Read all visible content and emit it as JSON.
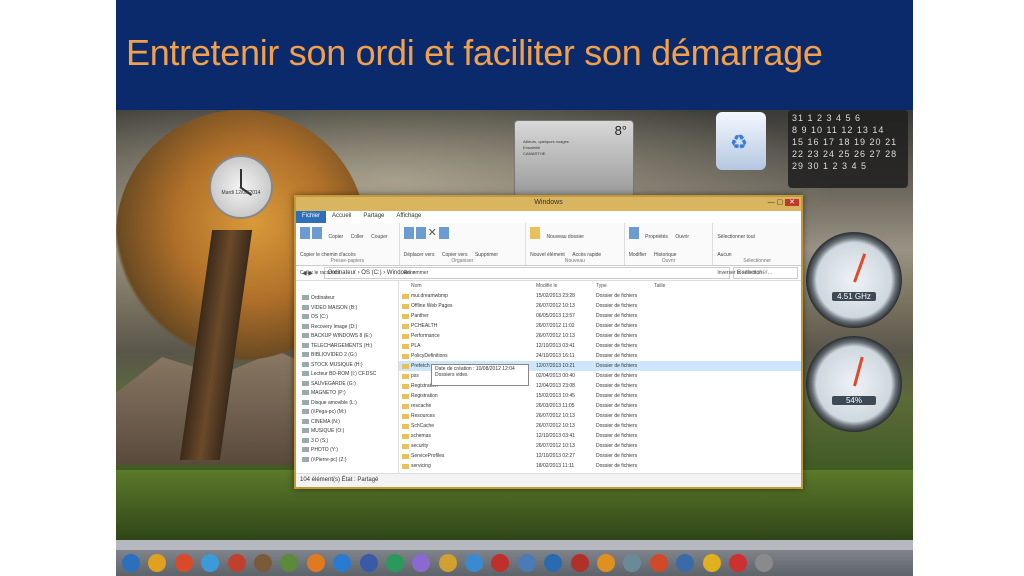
{
  "slide": {
    "title": "Entretenir son ordi et faciliter son démarrage"
  },
  "gadgets": {
    "clock": {
      "date": "Mardi 12/08/2014"
    },
    "weather": {
      "temp": "8°",
      "line1": "Ailleurs, quelques nuages",
      "line2": "Ensoleillé",
      "city": "CAMARTHE"
    },
    "calendar": {
      "rows": [
        "31  1  2  3  4  5  6",
        " 8  9 10 11 12 13 14",
        "15 16 17 18 19 20 21",
        "22 23 24 25 26 27 28",
        "29 30  1  2  3  4  5"
      ]
    },
    "gauge1": {
      "value": "4.51 GHz"
    },
    "gauge2": {
      "value": "54%"
    }
  },
  "explorer": {
    "title": "Windows",
    "tabs": [
      "Fichier",
      "Accueil",
      "Partage",
      "Affichage"
    ],
    "ribbon": {
      "groups": [
        {
          "caption": "Presse-papiers",
          "items": [
            "Copier",
            "Coller",
            "Couper",
            "Copier le chemin d'accès",
            "Coller le raccourci"
          ]
        },
        {
          "caption": "Organiser",
          "items": [
            "Déplacer vers",
            "Copier vers",
            "Supprimer",
            "Renommer"
          ]
        },
        {
          "caption": "Nouveau",
          "items": [
            "Nouveau dossier",
            "Nouvel élément",
            "Accès rapide"
          ]
        },
        {
          "caption": "Ouvrir",
          "items": [
            "Propriétés",
            "Ouvrir",
            "Modifier",
            "Historique"
          ]
        },
        {
          "caption": "Sélectionner",
          "items": [
            "Sélectionner tout",
            "Aucun",
            "Inverser la sélection"
          ]
        }
      ]
    },
    "address": {
      "path": "Ordinateur  ›  OS (C:)  ›  Windows  ›",
      "search_placeholder": "Rechercher..."
    },
    "nav_items": [
      "Ordinateur",
      "VIDEO MAISON (B:)",
      "OS (C:)",
      "Recovery Image (D:)",
      "BACKUP WINDOWS 8 (E:)",
      "TELECHARGEMENTS (H:)",
      "BIBLIOVIDEO 2 (G:)",
      "STOCK MUSIQUE (H:)",
      "Lecteur BD-ROM (I:) CF.DSC",
      "SAUVEGARDE (G:)",
      "MAGNETO (P:)",
      "Disque amovible (L:)",
      "(\\\\Pega-pc) (M:)",
      "CINEMA (N:)",
      "MUSIQUE (O:)",
      "3 D (S:)",
      "PHOTO (Y:)",
      "(\\\\Pierre-pc) (Z:)"
    ],
    "columns": [
      "Nom",
      "Modifié le",
      "Type",
      "Taille"
    ],
    "files": [
      {
        "name": "mui.dreamwbmp",
        "date": "15/02/2013 23:28",
        "type": "Dossier de fichiers"
      },
      {
        "name": "Offline Web Pages",
        "date": "26/07/2012 10:13",
        "type": "Dossier de fichiers"
      },
      {
        "name": "Panther",
        "date": "06/05/2013 13:57",
        "type": "Dossier de fichiers"
      },
      {
        "name": "PCHEALTH",
        "date": "26/07/2012 11:02",
        "type": "Dossier de fichiers"
      },
      {
        "name": "Performance",
        "date": "26/07/2012 10:13",
        "type": "Dossier de fichiers"
      },
      {
        "name": "PLA",
        "date": "12/10/2013 03:41",
        "type": "Dossier de fichiers"
      },
      {
        "name": "PolicyDefinitions",
        "date": "24/10/2013 16:11",
        "type": "Dossier de fichiers"
      },
      {
        "name": "Prefetch",
        "date": "12/07/2013 10:21",
        "type": "Dossier de fichiers"
      },
      {
        "name": "pss",
        "date": "02/04/2013 00:40",
        "type": "Dossier de fichiers"
      },
      {
        "name": "Registration",
        "date": "12/04/2013 23:08",
        "type": "Dossier de fichiers"
      },
      {
        "name": "Registration",
        "date": "15/02/2013 10:45",
        "type": "Dossier de fichiers"
      },
      {
        "name": "rescache",
        "date": "26/03/2013 11:05",
        "type": "Dossier de fichiers"
      },
      {
        "name": "Resources",
        "date": "26/07/2012 10:13",
        "type": "Dossier de fichiers"
      },
      {
        "name": "SchCache",
        "date": "26/07/2012 10:13",
        "type": "Dossier de fichiers"
      },
      {
        "name": "schemas",
        "date": "12/10/2013 03:41",
        "type": "Dossier de fichiers"
      },
      {
        "name": "security",
        "date": "26/07/2012 10:13",
        "type": "Dossier de fichiers"
      },
      {
        "name": "ServiceProfiles",
        "date": "12/10/2013 02:27",
        "type": "Dossier de fichiers"
      },
      {
        "name": "servicing",
        "date": "18/02/2013 11:11",
        "type": "Dossier de fichiers"
      }
    ],
    "tooltip": {
      "line1": "Date de création : 10/08/2012 12:04",
      "line2": "Dossiers vides"
    },
    "status": "104 élément(s)   État : Partagé"
  }
}
